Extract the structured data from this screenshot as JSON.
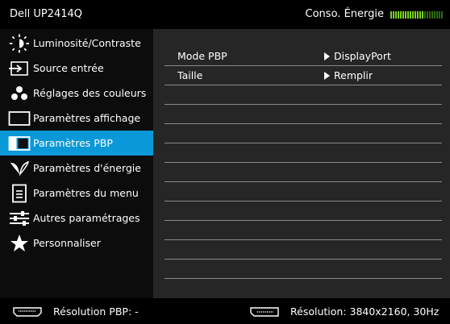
{
  "header": {
    "model": "Dell UP2414Q",
    "energy_label": "Conso. Énergie",
    "energy_level": 0.62,
    "energy_color": "#7bd21c"
  },
  "menu": {
    "items": [
      {
        "label": "Luminosité/Contraste",
        "icon": "brightness-icon"
      },
      {
        "label": "Source entrée",
        "icon": "input-source-icon"
      },
      {
        "label": "Réglages des couleurs",
        "icon": "color-settings-icon"
      },
      {
        "label": "Paramètres affichage",
        "icon": "display-icon"
      },
      {
        "label": "Paramètres PBP",
        "icon": "pbp-icon",
        "active": true
      },
      {
        "label": "Paramètres d'énergie",
        "icon": "energy-leaf-icon"
      },
      {
        "label": "Paramètres du menu",
        "icon": "menu-doc-icon"
      },
      {
        "label": "Autres paramétrages",
        "icon": "sliders-icon"
      },
      {
        "label": "Personnaliser",
        "icon": "star-icon"
      }
    ],
    "active_color": "#0a98d8"
  },
  "panel": {
    "rows": [
      {
        "label": "Mode PBP",
        "value": "DisplayPort"
      },
      {
        "label": "Taille",
        "value": "Remplir"
      },
      {
        "label": "",
        "value": ""
      },
      {
        "label": "",
        "value": ""
      },
      {
        "label": "",
        "value": ""
      },
      {
        "label": "",
        "value": ""
      },
      {
        "label": "",
        "value": ""
      },
      {
        "label": "",
        "value": ""
      },
      {
        "label": "",
        "value": ""
      },
      {
        "label": "",
        "value": ""
      },
      {
        "label": "",
        "value": ""
      },
      {
        "label": "",
        "value": ""
      },
      {
        "label": "",
        "value": ""
      }
    ]
  },
  "footer": {
    "left_text": "Résolution PBP: -",
    "right_text": "Résolution: 3840x2160, 30Hz",
    "left_icon": "hdmi-connector-icon",
    "right_icon": "displayport-connector-icon"
  }
}
